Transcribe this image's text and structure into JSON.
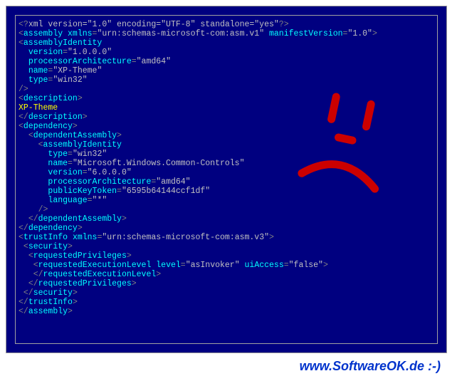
{
  "xml": {
    "decl_open": "<?",
    "decl_name": "xml",
    "decl_attrs": " version=\"1.0\" encoding=\"UTF-8\" standalone=\"yes\"",
    "decl_close": "?>",
    "assembly_open": "assembly",
    "assembly_attr1_name": "xmlns",
    "assembly_attr1_val": "\"urn:schemas-microsoft-com:asm.v1\"",
    "assembly_attr2_name": "manifestVersion",
    "assembly_attr2_val": "\"1.0\"",
    "ai": "assemblyIdentity",
    "ai_version_name": "version",
    "ai_version_val": "\"1.0.0.0\"",
    "ai_pa_name": "processorArchitecture",
    "ai_pa_val": "\"amd64\"",
    "ai_name_name": "name",
    "ai_name_val": "\"XP-Theme\"",
    "ai_type_name": "type",
    "ai_type_val": "\"win32\"",
    "desc": "description",
    "desc_text": "XP-Theme",
    "dep": "dependency",
    "depAsm": "dependentAssembly",
    "dai_type_val": "\"win32\"",
    "dai_name_val": "\"Microsoft.Windows.Common-Controls\"",
    "dai_version_val": "\"6.0.0.0\"",
    "dai_pa_val": "\"amd64\"",
    "dai_pkt_name": "publicKeyToken",
    "dai_pkt_val": "\"6595b64144ccf1df\"",
    "dai_lang_name": "language",
    "dai_lang_val": "\"*\"",
    "ti": "trustInfo",
    "ti_xmlns_val": "\"urn:schemas-microsoft-com:asm.v3\"",
    "sec": "security",
    "rp": "requestedPrivileges",
    "rel": "requestedExecutionLevel",
    "rel_level_name": "level",
    "rel_level_val": "\"asInvoker\"",
    "rel_uia_name": "uiAccess",
    "rel_uia_val": "\"false\""
  },
  "footer": "www.SoftwareOK.de :-)",
  "colors": {
    "background": "#000080",
    "punct": "#808080",
    "tag": "#00ffff",
    "value": "#c0c0c0",
    "text": "#ffff00",
    "smiley": "#cc0000",
    "footer": "#0033cc"
  }
}
